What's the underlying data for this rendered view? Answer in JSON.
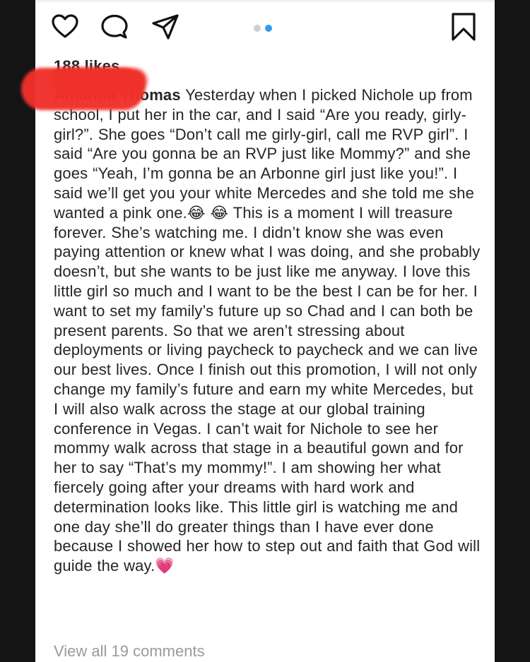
{
  "post": {
    "likes_text": "188 likes",
    "caption_username": "Amanda Thomas",
    "caption_text": " Yesterday when I picked Nichole up from school, I put her in the car, and I said “Are you ready, girly-girl?”. She goes “Don’t call me girly-girl, call me RVP girl”. I said “Are you gonna be an RVP just like Mommy?” and she goes “Yeah, I’m gonna be an Arbonne girl just like you!”. I said we’ll get you your white Mercedes and she told me she wanted a pink one.😂 😂 This is a moment I will treasure forever. She’s watching me. I didn’t know she was even paying attention or knew what I was doing, and she probably doesn’t, but she wants to be just like me anyway. I love this little girl so much and I want to be the best I can be for her. I want to set my family’s future up so Chad and I can both be present parents. So that we aren’t stressing about deployments or living paycheck to paycheck and we can live our best lives. Once I finish out this promotion, I will not only change my family’s future and earn my white Mercedes, but I will also walk across the stage at our global training conference in Vegas. I can’t wait for Nichole to see her mommy walk across that stage in a beautiful gown and for her to say “That’s my mommy!”. I am showing her what fiercely going after your dreams with hard work and determination looks like. This little girl is watching me and one day she’ll do greater things than I have ever done because I showed her how to step out and faith that God will guide the way.💗",
    "view_comments_text": "View all 19 comments"
  },
  "actions": {
    "like_icon": "heart-outline-icon",
    "comment_icon": "speech-bubble-icon",
    "share_icon": "paper-plane-icon",
    "save_icon": "bookmark-outline-icon"
  },
  "carousel": {
    "count": 2,
    "active_index": 1
  },
  "colors": {
    "accent": "#3897f0",
    "text": "#262626",
    "muted": "#9a9a9a",
    "redaction": "#f0302a"
  }
}
